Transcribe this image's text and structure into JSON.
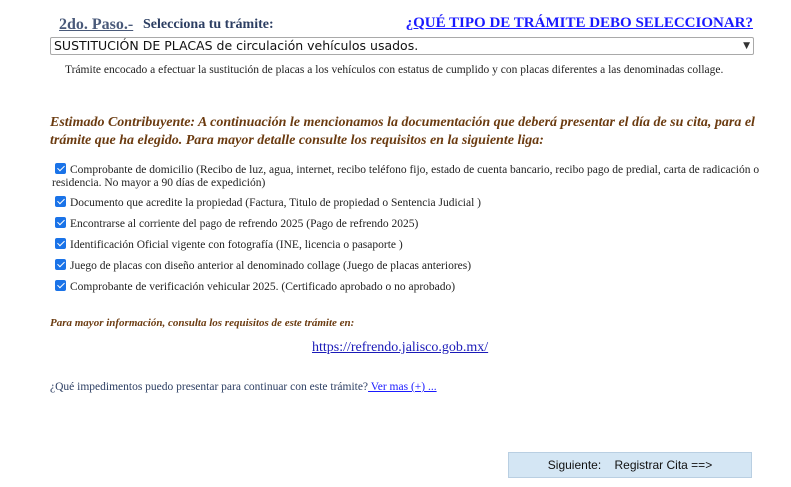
{
  "step": {
    "label": "2do. Paso.-",
    "description": "Selecciona tu trámite:",
    "help_link": "¿QUÉ TIPO DE TRÁMITE DEBO SELECCIONAR?"
  },
  "procedure_select": {
    "selected_value": "SUSTITUCIÓN DE PLACAS de circulación vehículos usados.",
    "arrow": "▼"
  },
  "procedure_description": "Trámite encocado a efectuar la sustitución de placas a los vehículos con estatus de cumplido y con placas diferentes a las denominadas collage.",
  "notice": "Estimado Contribuyente: A continuación le mencionamos la documentación que deberá presentar el día de su cita, para el trámite que ha elegido. Para mayor detalle consulte los requisitos en la siguiente liga:",
  "requirements": [
    {
      "label": "Comprobante de domicilio (Recibo de luz, agua, internet, recibo teléfono fijo, estado de cuenta bancario, recibo pago de predial, carta de radicación o residencia. No mayor a 90 días de expedición)",
      "checked": true
    },
    {
      "label": "Documento que acredite la propiedad (Factura, Titulo de propiedad o Sentencia Judicial )",
      "checked": true
    },
    {
      "label": "Encontrarse al corriente del pago de refrendo 2025 (Pago de refrendo 2025)",
      "checked": true
    },
    {
      "label": "Identificación Oficial vigente con fotografía (INE, licencia o pasaporte )",
      "checked": true
    },
    {
      "label": "Juego de placas con diseño anterior al denominado collage (Juego de placas anteriores)",
      "checked": true
    },
    {
      "label": "Comprobante de verificación vehicular 2025. (Certificado aprobado o no aprobado)",
      "checked": true
    }
  ],
  "more_info": "Para mayor información, consulta los requisitos de este trámite en:",
  "requirements_url": "https://refrendo.jalisco.gob.mx/",
  "impediments": {
    "question": "¿Qué impedimentos puedo presentar para continuar con este trámite?",
    "link": " Ver mas (+) ..."
  },
  "next_button": "Siguiente:    Registrar Cita ==>",
  "colors": {
    "checkbox": "#1a73e8",
    "link": "#1a1aff",
    "notice_text": "#6b3b10",
    "button_bg": "#d4e6f4"
  }
}
